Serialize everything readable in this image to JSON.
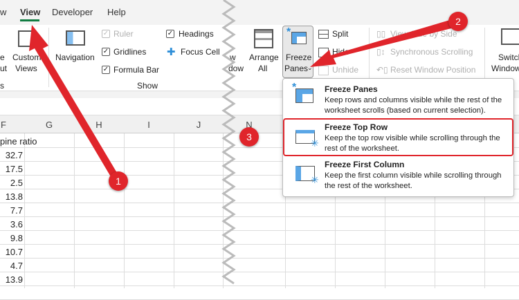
{
  "tabs": [
    "w",
    "View",
    "Developer",
    "Help"
  ],
  "ribbon": {
    "partial_left": [
      "e",
      "ut"
    ],
    "custom_views": [
      "Custom",
      "Views"
    ],
    "partial_group": "s",
    "navigation": "Navigation",
    "ruler": "Ruler",
    "gridlines": "Gridlines",
    "formula_bar": "Formula Bar",
    "headings": "Headings",
    "focus_cell": "Focus Cell",
    "show_group": "Show",
    "new_window_partial": [
      "w",
      "dow"
    ],
    "arrange_all": [
      "Arrange",
      "All"
    ],
    "freeze_panes": [
      "Freeze",
      "Panes"
    ],
    "split": "Split",
    "hide": "Hide",
    "unhide": "Unhide",
    "view_side_by_side": "View Side by Side",
    "sync_scrolling": "Synchronous Scrolling",
    "reset_window": "Reset Window Position",
    "switch_windows": [
      "Switch",
      "Windows"
    ]
  },
  "columns": [
    "F",
    "G",
    "H",
    "I",
    "J",
    "N"
  ],
  "cells": {
    "header": "pine ratio",
    "values": [
      "32.7",
      "17.5",
      "2.5",
      "13.8",
      "7.7",
      "3.6",
      "9.8",
      "10.7",
      "4.7",
      "13.9"
    ]
  },
  "menu": [
    {
      "title": "Freeze Panes",
      "desc": "Keep rows and columns visible while the rest of the worksheet scrolls (based on current selection)."
    },
    {
      "title": "Freeze Top Row",
      "desc": "Keep the top row visible while scrolling through the rest of the worksheet."
    },
    {
      "title": "Freeze First Column",
      "desc": "Keep the first column visible while scrolling through the rest of the worksheet."
    }
  ],
  "badges": [
    "1",
    "2",
    "3"
  ],
  "colors": {
    "accent": "#107c41",
    "annotation": "#e0252b",
    "icon_blue": "#2f8fd8"
  }
}
